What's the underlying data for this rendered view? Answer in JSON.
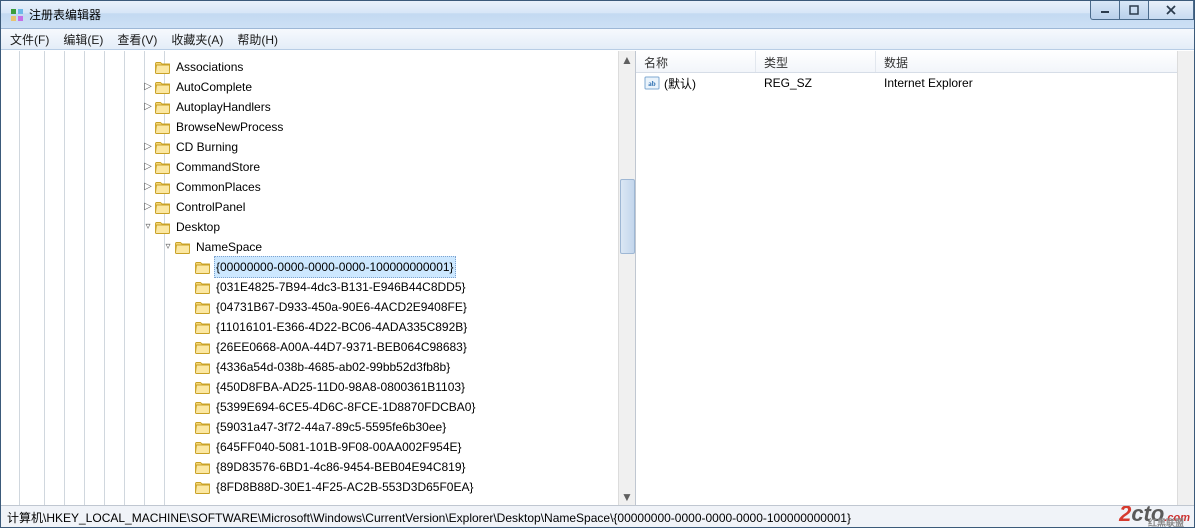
{
  "window": {
    "title": "注册表编辑器"
  },
  "menu": {
    "file": "文件(F)",
    "edit": "编辑(E)",
    "view": "查看(V)",
    "favorites": "收藏夹(A)",
    "help": "帮助(H)"
  },
  "tree": {
    "items": [
      {
        "depth": 7,
        "toggle": "",
        "label": "Associations"
      },
      {
        "depth": 7,
        "toggle": "closed",
        "label": "AutoComplete"
      },
      {
        "depth": 7,
        "toggle": "closed",
        "label": "AutoplayHandlers"
      },
      {
        "depth": 7,
        "toggle": "",
        "label": "BrowseNewProcess"
      },
      {
        "depth": 7,
        "toggle": "closed",
        "label": "CD Burning"
      },
      {
        "depth": 7,
        "toggle": "closed",
        "label": "CommandStore"
      },
      {
        "depth": 7,
        "toggle": "closed",
        "label": "CommonPlaces"
      },
      {
        "depth": 7,
        "toggle": "closed",
        "label": "ControlPanel"
      },
      {
        "depth": 7,
        "toggle": "open",
        "label": "Desktop"
      },
      {
        "depth": 8,
        "toggle": "open",
        "label": "NameSpace"
      },
      {
        "depth": 9,
        "toggle": "",
        "label": "{00000000-0000-0000-0000-100000000001}",
        "selected": true
      },
      {
        "depth": 9,
        "toggle": "",
        "label": "{031E4825-7B94-4dc3-B131-E946B44C8DD5}"
      },
      {
        "depth": 9,
        "toggle": "",
        "label": "{04731B67-D933-450a-90E6-4ACD2E9408FE}"
      },
      {
        "depth": 9,
        "toggle": "",
        "label": "{11016101-E366-4D22-BC06-4ADA335C892B}"
      },
      {
        "depth": 9,
        "toggle": "",
        "label": "{26EE0668-A00A-44D7-9371-BEB064C98683}"
      },
      {
        "depth": 9,
        "toggle": "",
        "label": "{4336a54d-038b-4685-ab02-99bb52d3fb8b}"
      },
      {
        "depth": 9,
        "toggle": "",
        "label": "{450D8FBA-AD25-11D0-98A8-0800361B1103}"
      },
      {
        "depth": 9,
        "toggle": "",
        "label": "{5399E694-6CE5-4D6C-8FCE-1D8870FDCBA0}"
      },
      {
        "depth": 9,
        "toggle": "",
        "label": "{59031a47-3f72-44a7-89c5-5595fe6b30ee}"
      },
      {
        "depth": 9,
        "toggle": "",
        "label": "{645FF040-5081-101B-9F08-00AA002F954E}"
      },
      {
        "depth": 9,
        "toggle": "",
        "label": "{89D83576-6BD1-4c86-9454-BEB04E94C819}"
      },
      {
        "depth": 9,
        "toggle": "",
        "label": "{8FD8B88D-30E1-4F25-AC2B-553D3D65F0EA}"
      }
    ]
  },
  "list": {
    "columns": {
      "name": "名称",
      "type": "类型",
      "data": "数据"
    },
    "col_widths": {
      "name": 120,
      "type": 120,
      "data": 280
    },
    "rows": [
      {
        "name": "(默认)",
        "type": "REG_SZ",
        "data": "Internet Explorer"
      }
    ]
  },
  "status": {
    "path": "计算机\\HKEY_LOCAL_MACHINE\\SOFTWARE\\Microsoft\\Windows\\CurrentVersion\\Explorer\\Desktop\\NameSpace\\{00000000-0000-0000-0000-100000000001}"
  },
  "watermark": {
    "part1": "2",
    "part2": "cto",
    "part3": ".com",
    "cn": "红黑联盟"
  }
}
